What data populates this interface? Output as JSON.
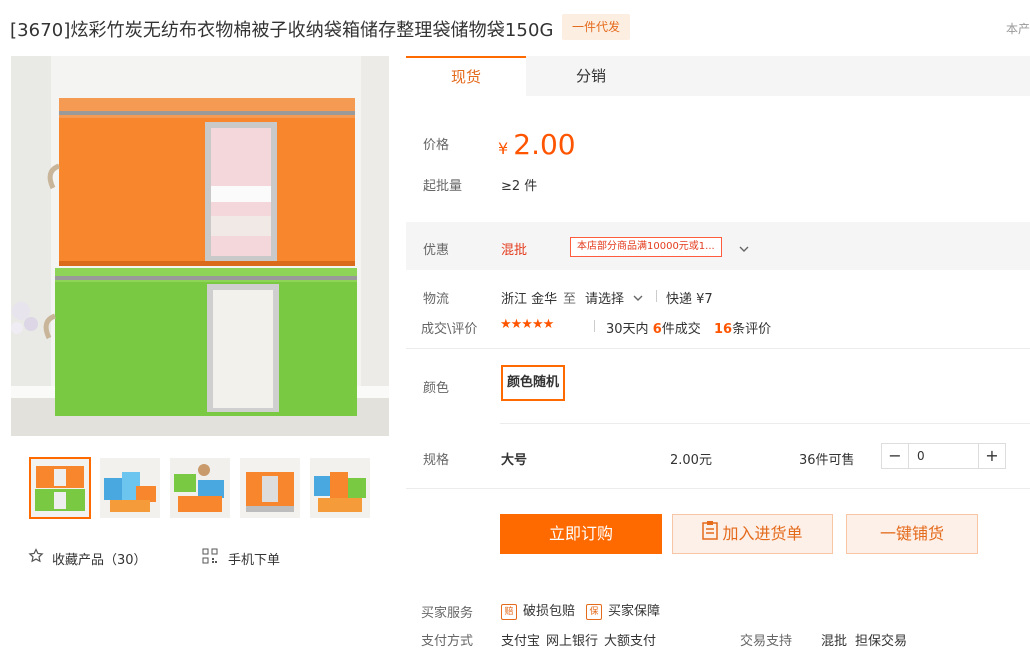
{
  "product": {
    "title": "[3670]炫彩竹炭无纺布衣物棉被子收纳袋箱储存整理袋储物袋150G",
    "badge": "一件代发",
    "right_cut_text": "本产"
  },
  "gallery": {
    "thumbnail_count": 5,
    "favorite_label": "收藏产品（30）",
    "mobile_order_label": "手机下单"
  },
  "tabs": [
    {
      "label": "现货",
      "active": true
    },
    {
      "label": "分销",
      "active": false
    }
  ],
  "pricing": {
    "price_label": "价格",
    "currency": "¥",
    "price": "2.00",
    "moq_label": "起批量",
    "moq_value": "≥2 件"
  },
  "promo": {
    "label": "优惠",
    "type": "混批",
    "tag": "本店部分商品满10000元或1..."
  },
  "logistics": {
    "label": "物流",
    "origin": "浙江 金华",
    "to_word": "至",
    "destination": "请选择",
    "express": "快递 ¥7"
  },
  "reviews": {
    "label": "成交\\评价",
    "rating": 4.5,
    "stars": "★★★★★",
    "sales_prefix": "30天内",
    "sales_count": "6",
    "sales_suffix": "件成交",
    "review_count": "16",
    "review_suffix": "条评价"
  },
  "color": {
    "label": "颜色",
    "option": "颜色随机"
  },
  "spec": {
    "label": "规格",
    "name": "大号",
    "price": "2.00元",
    "stock": "36件可售",
    "quantity": "0",
    "minus": "−",
    "plus": "+"
  },
  "actions": {
    "buy_now": "立即订购",
    "add_cart": "加入进货单",
    "one_click": "一键铺货"
  },
  "services": {
    "buyer_label": "买家服务",
    "items": [
      "破损包赔",
      "买家保障"
    ],
    "item_icons": [
      "赔",
      "保"
    ],
    "payment_label": "支付方式",
    "payments": [
      "支付宝",
      "网上银行",
      "大额支付"
    ],
    "trade_label": "交易支持",
    "trade_items": [
      "混批",
      "担保交易"
    ]
  },
  "colors": {
    "accent": "#ff6a00",
    "price": "#ff5500",
    "badge_bg": "#fdeee2"
  }
}
